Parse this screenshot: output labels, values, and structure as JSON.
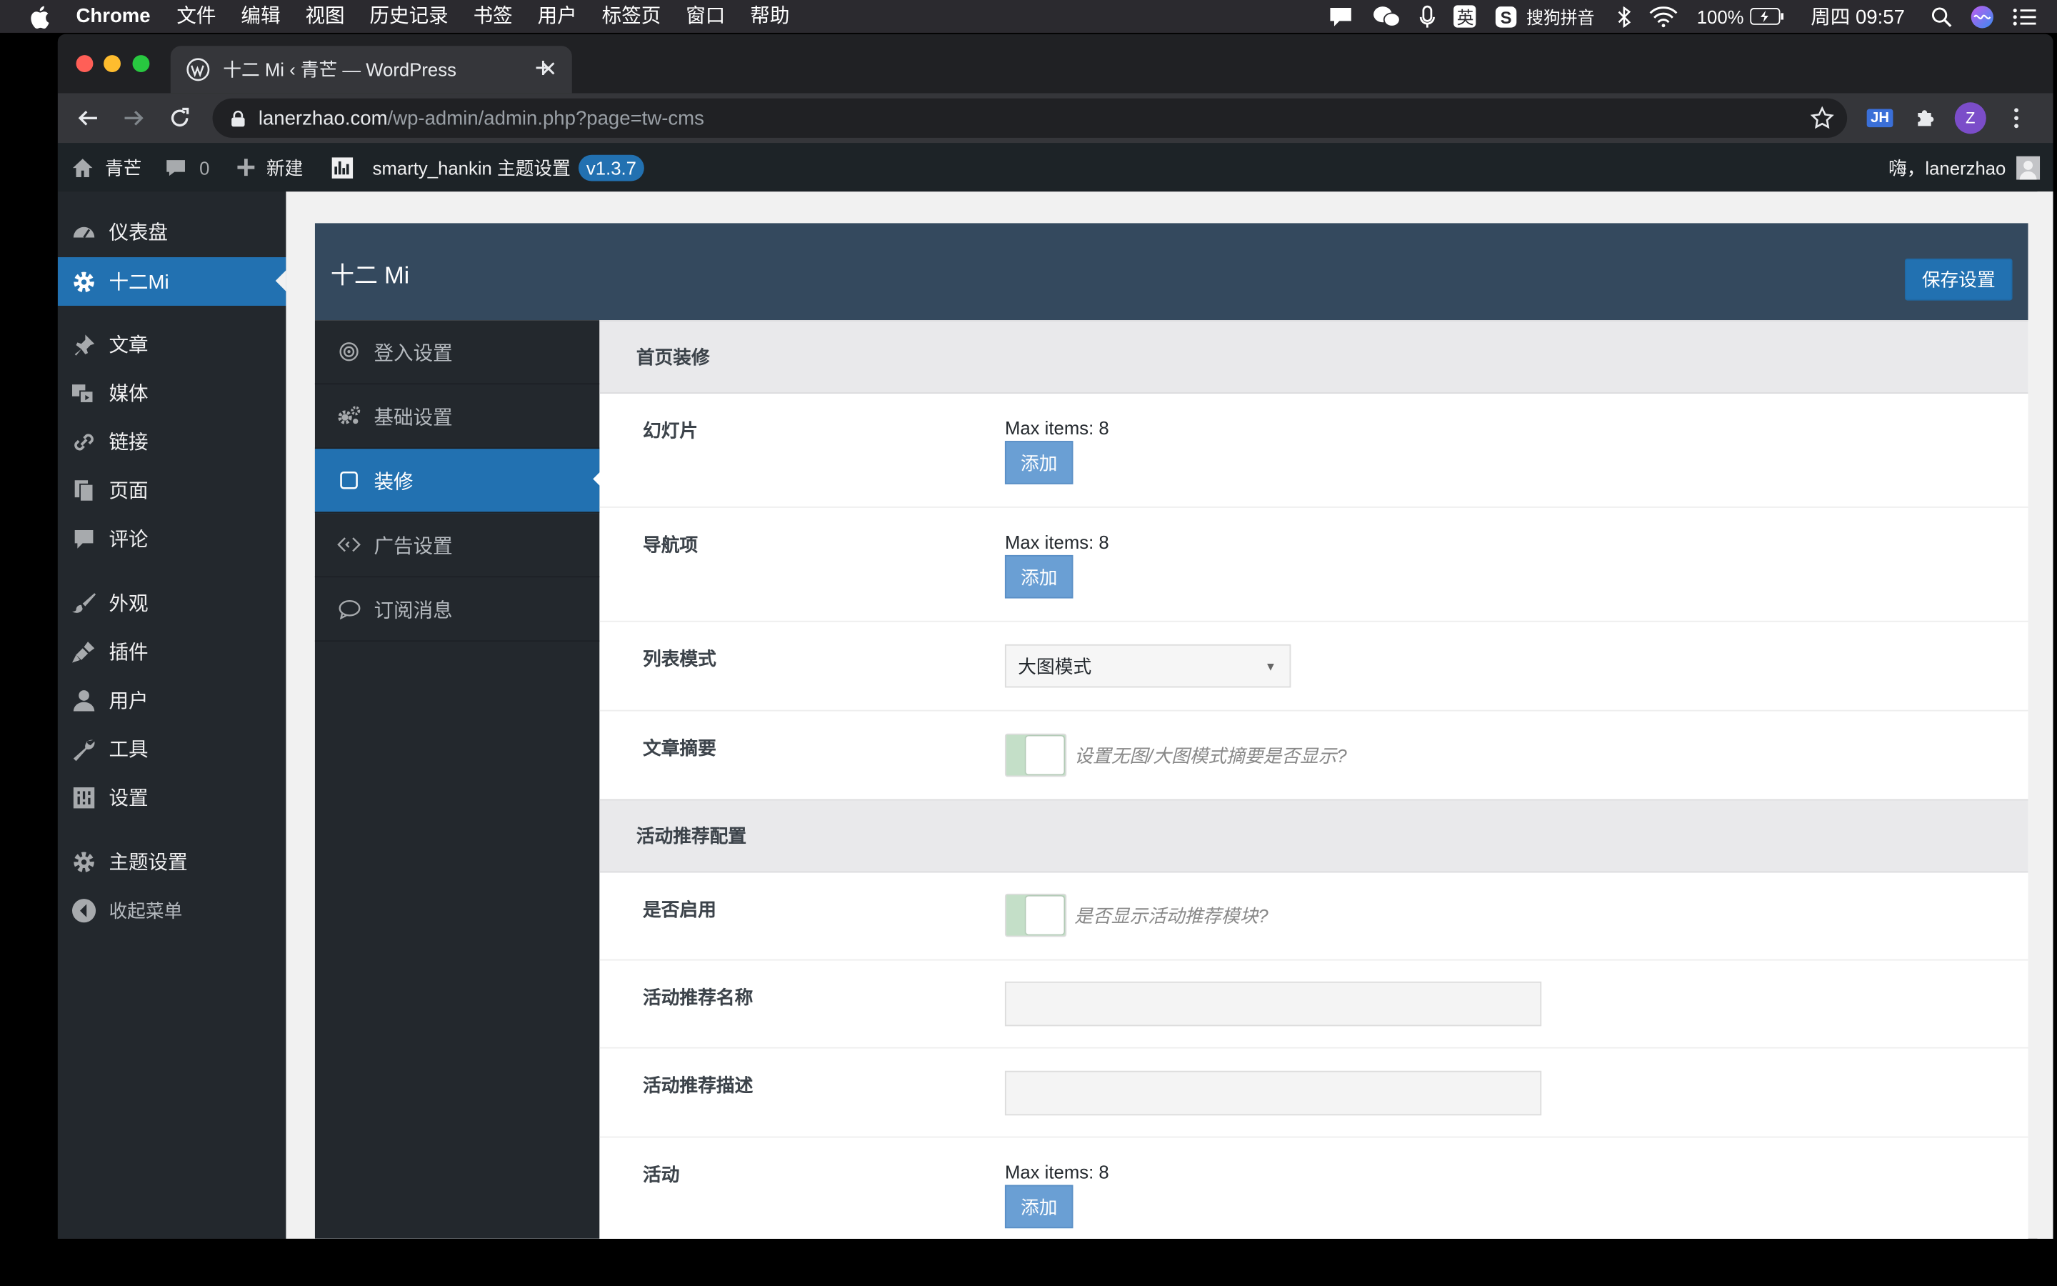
{
  "menubar": {
    "app": "Chrome",
    "items": [
      "文件",
      "编辑",
      "视图",
      "历史记录",
      "书签",
      "用户",
      "标签页",
      "窗口",
      "帮助"
    ],
    "input_lang": "英",
    "ime": "搜狗拼音",
    "battery": "100%",
    "clock": "周四 09:57"
  },
  "browser": {
    "tab_title": "十二 Mi ‹ 青芒 — WordPress",
    "url_host": "lanerzhao.com",
    "url_path": "/wp-admin/admin.php?page=tw-cms",
    "ext_badge": "JH",
    "profile_initial": "Z"
  },
  "adminbar": {
    "site": "青芒",
    "comments": "0",
    "new": "新建",
    "theme": "smarty_hankin 主题设置",
    "version": "v1.3.7",
    "greeting": "嗨，lanerzhao"
  },
  "wpmenu": {
    "items": [
      "仪表盘",
      "十二Mi",
      "文章",
      "媒体",
      "链接",
      "页面",
      "评论",
      "外观",
      "插件",
      "用户",
      "工具",
      "设置",
      "主题设置",
      "收起菜单"
    ]
  },
  "panel": {
    "title": "十二 Mi",
    "save": "保存设置",
    "nav": [
      "登入设置",
      "基础设置",
      "装修",
      "广告设置",
      "订阅消息"
    ]
  },
  "form": {
    "section1": "首页装修",
    "slides_label": "幻灯片",
    "slides_max": "Max items: 8",
    "add": "添加",
    "navitems_label": "导航项",
    "navitems_max": "Max items: 8",
    "listmode_label": "列表模式",
    "listmode_value": "大图模式",
    "excerpt_label": "文章摘要",
    "excerpt_hint": "设置无图/大图模式摘要是否显示?",
    "section2": "活动推荐配置",
    "enable_label": "是否启用",
    "enable_hint": "是否显示活动推荐模块?",
    "act_name_label": "活动推荐名称",
    "act_desc_label": "活动推荐描述",
    "act_label": "活动",
    "act_max": "Max items: 8"
  },
  "colors": {
    "accent": "#2271b1",
    "panel_header": "#34495e",
    "sidebar": "#23282d",
    "add_button": "#6a9fd4",
    "switch_on": "#c4dfc8"
  }
}
